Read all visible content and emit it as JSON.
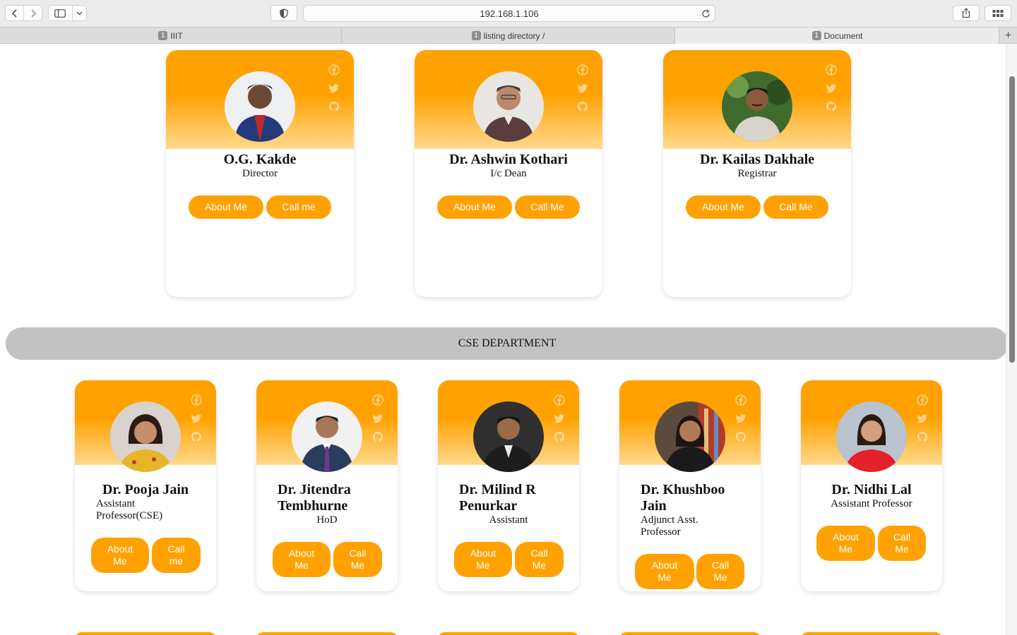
{
  "browser": {
    "url": "192.168.1.106",
    "tabs": [
      {
        "count": "1",
        "label": "IIIT"
      },
      {
        "count": "1",
        "label": "listing directory /"
      },
      {
        "count": "1",
        "label": "Document"
      }
    ],
    "new_tab_label": "+"
  },
  "colors": {
    "accent": "#ffa201",
    "accent_light": "#ffd98d",
    "section_bar": "#c2c2c2"
  },
  "social_icons": [
    "facebook-icon",
    "twitter-icon",
    "github-icon"
  ],
  "leadership": [
    {
      "name": "O.G. Kakde",
      "role": "Director",
      "about": "About Me",
      "call": "Call me"
    },
    {
      "name": "Dr. Ashwin Kothari",
      "role": "I/c Dean",
      "about": "About Me",
      "call": "Call Me"
    },
    {
      "name": "Dr. Kailas Dakhale",
      "role": "Registrar",
      "about": "About Me",
      "call": "Call Me"
    }
  ],
  "section_title": "CSE DEPARTMENT",
  "faculty": [
    {
      "name": "Dr. Pooja Jain",
      "role": "Assistant Professor(CSE)",
      "about": "About Me",
      "call": "Call me"
    },
    {
      "name": "Dr. Jitendra Tembhurne",
      "role": "HoD",
      "about": "About Me",
      "call": "Call Me"
    },
    {
      "name": "Dr. Milind R Penurkar",
      "role": "Assistant",
      "about": "About Me",
      "call": "Call Me"
    },
    {
      "name": "Dr. Khushboo Jain",
      "role": "Adjunct Asst. Professor",
      "about": "About Me",
      "call": "Call Me"
    },
    {
      "name": "Dr. Nidhi Lal",
      "role": "Assistant Professor",
      "about": "About Me",
      "call": "Call Me"
    }
  ]
}
